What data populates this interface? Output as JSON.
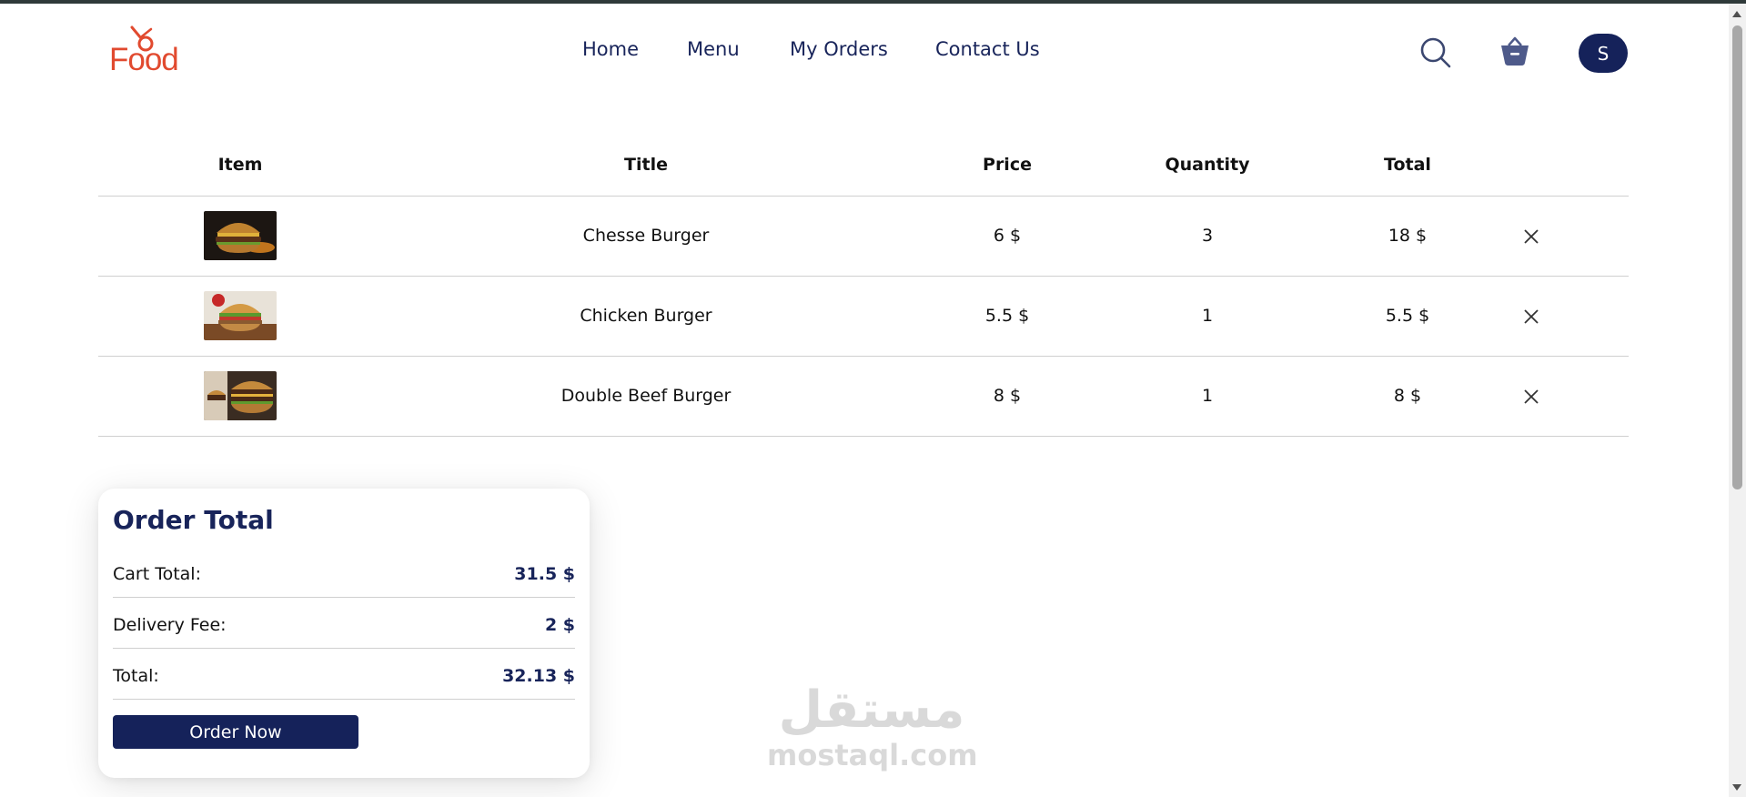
{
  "brand": {
    "logo_text": "Food",
    "color": "#e14a2f"
  },
  "nav": {
    "items": [
      {
        "label": "Home"
      },
      {
        "label": "Menu"
      },
      {
        "label": "My Orders"
      },
      {
        "label": "Contact Us"
      }
    ]
  },
  "header_icons": {
    "search": "search-icon",
    "basket": "basket-icon",
    "avatar_initial": "S"
  },
  "cart": {
    "headers": {
      "item": "Item",
      "title": "Title",
      "price": "Price",
      "quantity": "Quantity",
      "total": "Total"
    },
    "rows": [
      {
        "title": "Chesse Burger",
        "price": "6 $",
        "quantity": "3",
        "total": "18 $",
        "image": "burger-photo"
      },
      {
        "title": "Chicken Burger",
        "price": "5.5 $",
        "quantity": "1",
        "total": "5.5 $",
        "image": "burger-photo"
      },
      {
        "title": "Double Beef Burger",
        "price": "8 $",
        "quantity": "1",
        "total": "8 $",
        "image": "burger-photo"
      }
    ]
  },
  "order_total": {
    "title": "Order Total",
    "cart_total_label": "Cart Total:",
    "cart_total_value": "31.5 $",
    "delivery_label": "Delivery Fee:",
    "delivery_value": "2 $",
    "total_label": "Total:",
    "total_value": "32.13 $",
    "button_label": "Order Now"
  },
  "watermark": {
    "arabic": "مستقل",
    "latin": "mostaql.com"
  },
  "colors": {
    "primary": "#15225a",
    "accent": "#e14a2f",
    "divider": "#cfcfcf"
  }
}
